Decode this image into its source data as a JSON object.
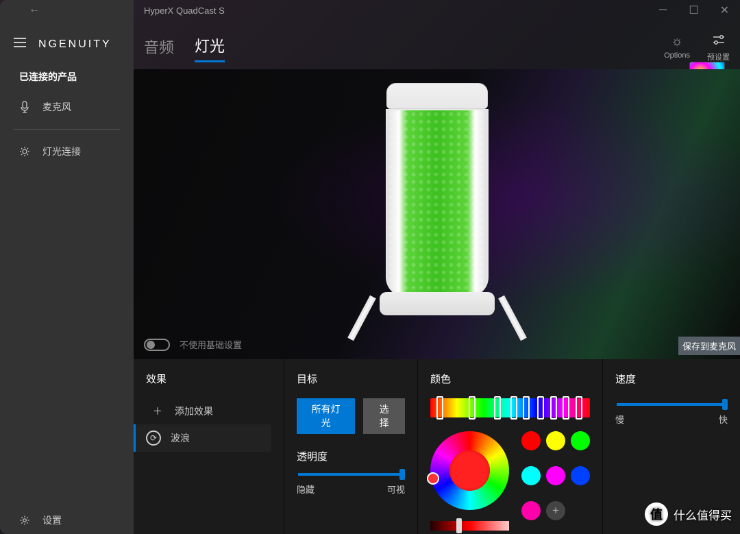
{
  "window": {
    "title": "HyperX QuadCast S"
  },
  "app_name": "NGENUITY",
  "sidebar": {
    "section_title": "已连接的产品",
    "items": [
      {
        "icon": "mic-icon",
        "label": "麦克风"
      },
      {
        "icon": "light-icon",
        "label": "灯光连接"
      }
    ],
    "settings_label": "设置"
  },
  "tabs": {
    "audio": "音频",
    "light": "灯光",
    "active": "light",
    "options_label": "Options",
    "presets_label": "预设置"
  },
  "base_toggle": {
    "state": "off",
    "label": "不使用基础设置"
  },
  "save_button": "保存到麦克风",
  "panels": {
    "effects": {
      "title": "效果",
      "add_label": "添加效果",
      "selected_label": "波浪"
    },
    "target": {
      "title": "目标",
      "all_lights": "所有灯光",
      "select": "选择",
      "opacity_title": "透明度",
      "opacity_min": "隐藏",
      "opacity_max": "可视",
      "opacity_value": 100
    },
    "color": {
      "title": "颜色",
      "hue_positions": [
        4,
        24,
        40,
        50,
        58,
        67,
        75,
        83,
        91
      ],
      "swatches": [
        "#ff0000",
        "#ffff00",
        "#00ff00",
        "#00ffff",
        "#ff00ff",
        "#0040ff",
        "#ff00aa"
      ],
      "brightness": 35
    },
    "speed": {
      "title": "速度",
      "min": "慢",
      "max": "快",
      "value": 95
    }
  },
  "watermark": {
    "badge": "值",
    "text": "什么值得买"
  }
}
